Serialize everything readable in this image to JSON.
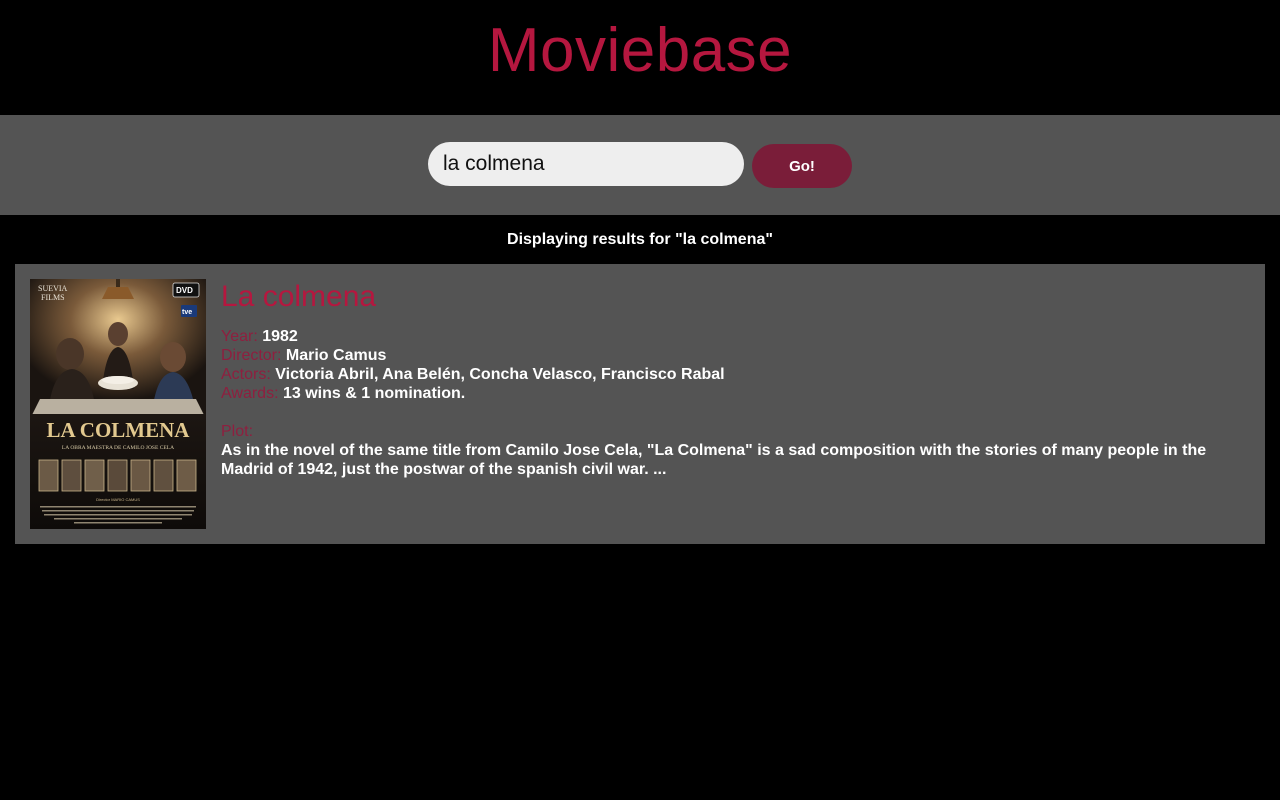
{
  "app": {
    "title": "Moviebase"
  },
  "search": {
    "value": "la colmena",
    "placeholder": "",
    "button_label": "Go!"
  },
  "results": {
    "caption": "Displaying results for \"la colmena\""
  },
  "movie": {
    "title": "La colmena",
    "year_label": "Year:",
    "year": "1982",
    "director_label": "Director:",
    "director": "Mario Camus",
    "actors_label": "Actors:",
    "actors": "Victoria Abril, Ana Belén, Concha Velasco, Francisco Rabal",
    "awards_label": "Awards:",
    "awards": "13 wins & 1 nomination.",
    "plot_label": "Plot:",
    "plot": "As in the novel of the same title from Camilo Jose Cela, \"La Colmena\" is a sad composition with the stories of many people in the Madrid of 1942, just the postwar of the spanish civil war. ...",
    "poster": {
      "studio_line1": "SUEVIA",
      "studio_line2": "FILMS",
      "format_badge": "DVD",
      "channel_badge": "tve",
      "poster_title": "LA COLMENA",
      "poster_subtitle": "LA OBRA MAESTRA DE CAMILO JOSE CELA",
      "director_credit": "Director MARIO CAMUS"
    }
  },
  "colors": {
    "brand": "#b5173f",
    "label": "#8e1f3f",
    "button": "#7a1d39",
    "panel": "#545454",
    "background": "#000000"
  }
}
